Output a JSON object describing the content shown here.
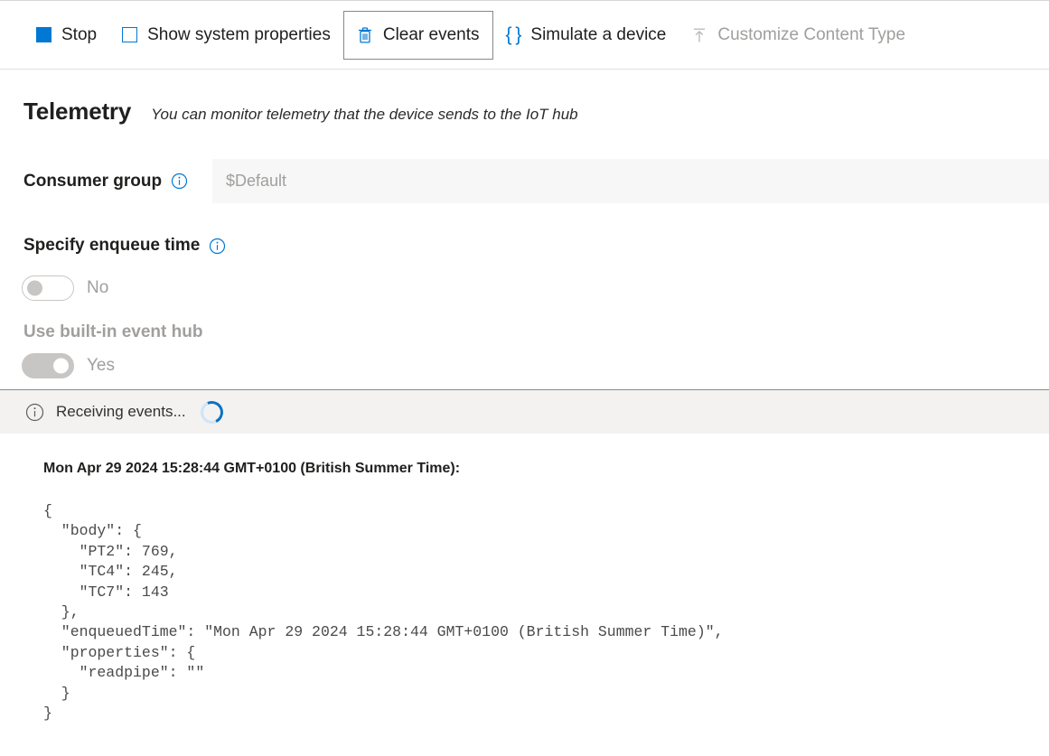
{
  "toolbar": {
    "items": [
      {
        "id": "stop",
        "label": "Stop",
        "icon": "stop-square-icon",
        "disabled": false,
        "focused": false
      },
      {
        "id": "show-system-properties",
        "label": "Show system properties",
        "icon": "checkbox-unchecked-icon",
        "disabled": false,
        "focused": false
      },
      {
        "id": "clear-events",
        "label": "Clear events",
        "icon": "trash-icon",
        "disabled": false,
        "focused": true
      },
      {
        "id": "simulate-a-device",
        "label": "Simulate a device",
        "icon": "curly-braces-icon",
        "disabled": false,
        "focused": false
      },
      {
        "id": "customize-content-type",
        "label": "Customize Content Type",
        "icon": "upload-arrow-icon",
        "disabled": true,
        "focused": false
      }
    ]
  },
  "header": {
    "title": "Telemetry",
    "subtitle": "You can monitor telemetry that the device sends to the IoT hub"
  },
  "consumer_group": {
    "label": "Consumer group",
    "info_icon": "info-circle-icon",
    "value": "",
    "placeholder": "$Default"
  },
  "enqueue_time": {
    "label": "Specify enqueue time",
    "info_icon": "info-circle-icon",
    "toggle_state": "off",
    "toggle_text": "No"
  },
  "built_in_event_hub": {
    "label": "Use built-in event hub",
    "toggle_state": "on",
    "toggle_text": "Yes",
    "disabled": true
  },
  "status_banner": {
    "icon": "info-circle-icon",
    "text": "Receiving events...",
    "spinner": "loading-spinner-icon"
  },
  "events": [
    {
      "timestamp": "Mon Apr 29 2024 15:28:44 GMT+0100 (British Summer Time):",
      "payload": "{\n  \"body\": {\n    \"PT2\": 769,\n    \"TC4\": 245,\n    \"TC7\": 143\n  },\n  \"enqueuedTime\": \"Mon Apr 29 2024 15:28:44 GMT+0100 (British Summer Time)\",\n  \"properties\": {\n    \"readpipe\": \"\"\n  }\n}"
    }
  ],
  "colors": {
    "accent": "#0078d4",
    "banner_bg": "#f3f2f1",
    "input_bg": "#f7f7f7",
    "disabled_text": "#a19f9d",
    "spinner": "#0a72c4"
  }
}
